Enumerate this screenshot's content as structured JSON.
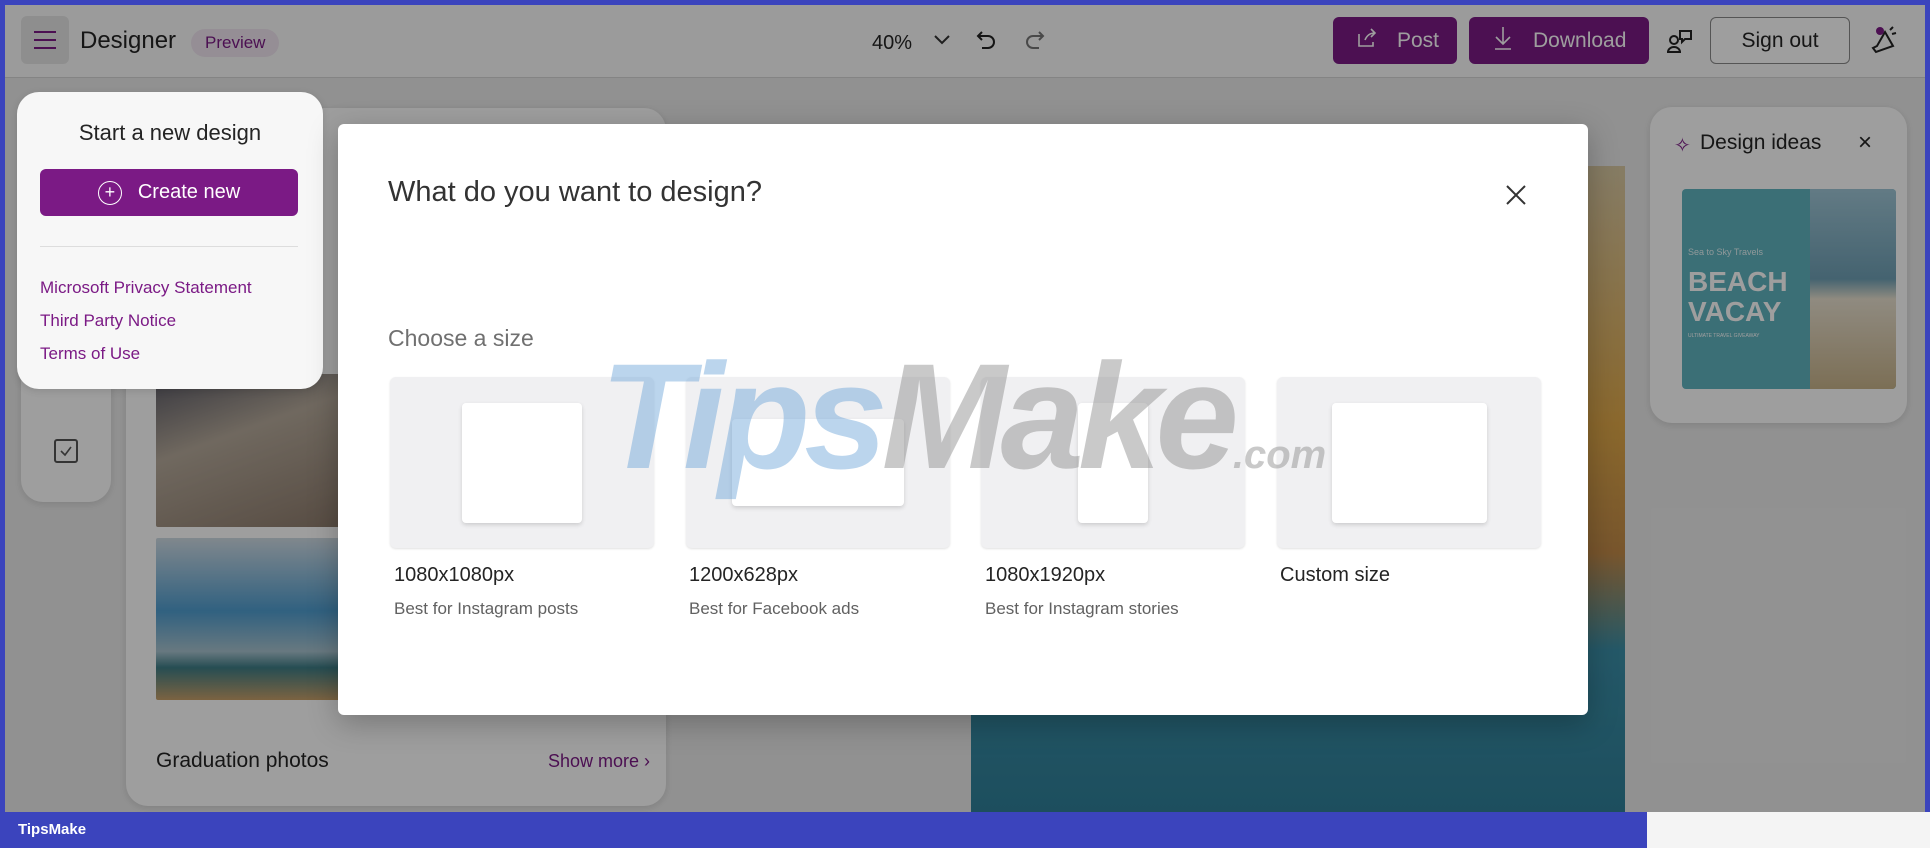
{
  "header": {
    "app_name": "Designer",
    "badge": "Preview",
    "zoom": "40%",
    "post": "Post",
    "download": "Download",
    "sign_out": "Sign out"
  },
  "start_panel": {
    "title": "Start a new design",
    "create_new": "Create new",
    "links": [
      "Microsoft Privacy Statement",
      "Third Party Notice",
      "Terms of Use"
    ]
  },
  "gallery": {
    "section_title": "Graduation photos",
    "show_more": "Show more"
  },
  "design_ideas": {
    "title": "Design ideas",
    "thumb_small": "Sea to Sky Travels",
    "thumb_title1": "BEACH",
    "thumb_title2": "VACAY",
    "thumb_sub": "ULTIMATE TRAVEL GIVEAWAY"
  },
  "modal": {
    "title": "What do you want to design?",
    "section": "Choose a size",
    "options": [
      {
        "label": "1080x1080px",
        "desc": "Best for Instagram posts"
      },
      {
        "label": "1200x628px",
        "desc": "Best for Facebook ads"
      },
      {
        "label": "1080x1920px",
        "desc": "Best for Instagram stories"
      },
      {
        "label": "Custom size",
        "desc": ""
      }
    ]
  },
  "watermark": {
    "text1": "Tips",
    "text2": "Make",
    ".com": ".com"
  },
  "footer": {
    "brand": "TipsMake"
  },
  "colors": {
    "accent": "#7b1a85",
    "frame": "#3b44bd"
  }
}
